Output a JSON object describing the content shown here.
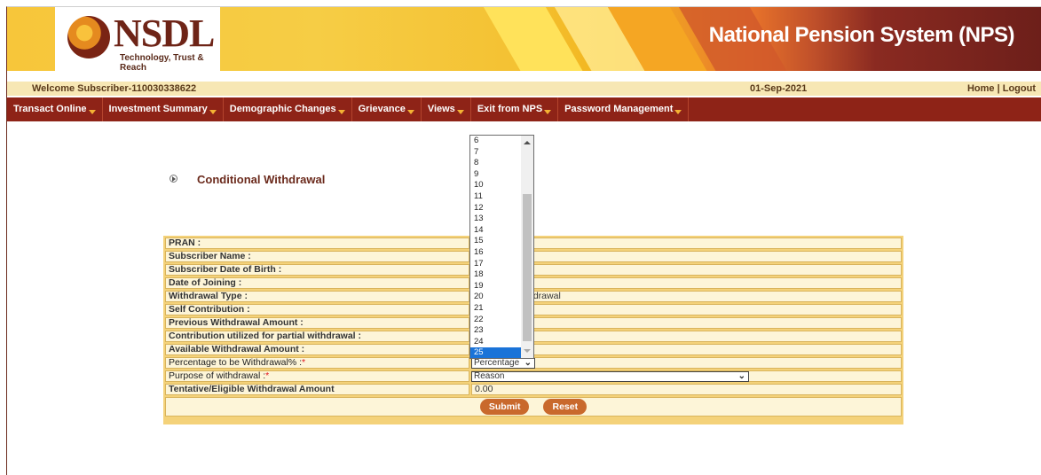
{
  "header": {
    "logo_text": "NSDL",
    "logo_tagline": "Technology, Trust & Reach",
    "system_title": "National Pension System (NPS)"
  },
  "welcome_bar": {
    "welcome": "Welcome Subscriber-110030338622",
    "date": "01-Sep-2021",
    "home": "Home",
    "separator": " | ",
    "logout": "Logout"
  },
  "nav": {
    "items": [
      {
        "label": "Transact Online"
      },
      {
        "label": "Investment Summary"
      },
      {
        "label": "Demographic Changes"
      },
      {
        "label": "Grievance"
      },
      {
        "label": "Views"
      },
      {
        "label": "Exit from NPS"
      },
      {
        "label": "Password Management"
      }
    ]
  },
  "page": {
    "title": "Conditional Withdrawal"
  },
  "form": {
    "rows": [
      {
        "label": "PRAN :",
        "value": ""
      },
      {
        "label": "Subscriber Name :",
        "value": ""
      },
      {
        "label": "Subscriber Date of Birth :",
        "value": ""
      },
      {
        "label": "Date of Joining :",
        "value": ""
      },
      {
        "label": "Withdrawal Type :",
        "value": "hdrawal"
      },
      {
        "label": "Self Contribution :",
        "value": ""
      },
      {
        "label": "Previous Withdrawal Amount :",
        "value": ""
      },
      {
        "label": "Contribution utilized for partial withdrawal :",
        "value": ""
      },
      {
        "label": "Available Withdrawal Amount :",
        "value": ""
      }
    ],
    "percentage_label": "Percentage to be Withdrawal% :",
    "percentage_select_value": "Percentage",
    "purpose_label": "Purpose of withdrawal :",
    "purpose_select_value": "Reason",
    "required_mark": "*",
    "tentative_label": "Tentative/Eligible Withdrawal Amount",
    "tentative_value": "0.00",
    "submit_label": "Submit",
    "reset_label": "Reset"
  },
  "dropdown": {
    "options": [
      "6",
      "7",
      "8",
      "9",
      "10",
      "11",
      "12",
      "13",
      "14",
      "15",
      "16",
      "17",
      "18",
      "19",
      "20",
      "21",
      "22",
      "23",
      "24",
      "25"
    ],
    "selected": "25"
  },
  "colors": {
    "nav_bg": "#8e2317",
    "welcome_bg": "#f7e7b4",
    "button_bg": "#c9692c",
    "selected_option": "#1a73d8"
  }
}
